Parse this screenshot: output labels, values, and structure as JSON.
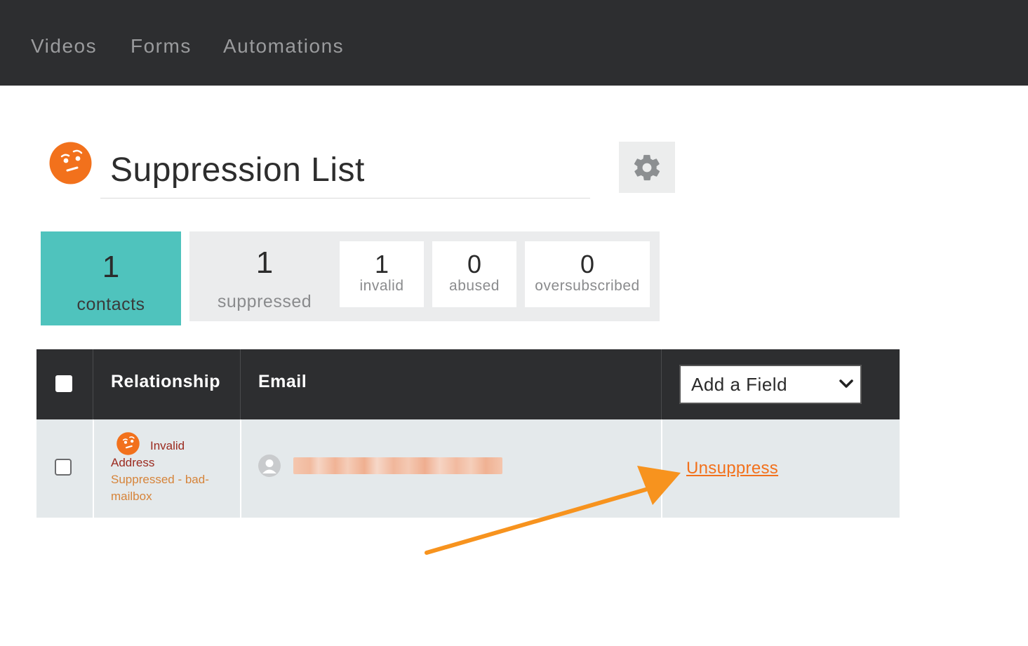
{
  "nav": {
    "items": [
      {
        "label": "Videos"
      },
      {
        "label": "Forms"
      },
      {
        "label": "Automations"
      }
    ]
  },
  "header": {
    "title": "Suppression List",
    "icon": "suspicious-face-icon",
    "settings_icon": "gear-icon"
  },
  "stats": {
    "contacts": {
      "count": "1",
      "label": "contacts"
    },
    "suppressed": {
      "count": "1",
      "label": "suppressed"
    },
    "invalid": {
      "count": "1",
      "label": "invalid"
    },
    "abused": {
      "count": "0",
      "label": "abused"
    },
    "oversubscribed": {
      "count": "0",
      "label": "oversubscribed"
    }
  },
  "table": {
    "columns": {
      "relationship": "Relationship",
      "email": "Email",
      "add_field": "Add a Field"
    },
    "rows": [
      {
        "relationship_status": "Invalid",
        "relationship_status_2": "Address",
        "reason_line1": "Suppressed - bad-",
        "reason_line2": "mailbox",
        "action": "Unsuppress"
      }
    ]
  },
  "colors": {
    "nav_bg": "#2d2e30",
    "accent_teal": "#4fc3bd",
    "accent_orange": "#f2711c",
    "arrow": "#f7931e"
  }
}
